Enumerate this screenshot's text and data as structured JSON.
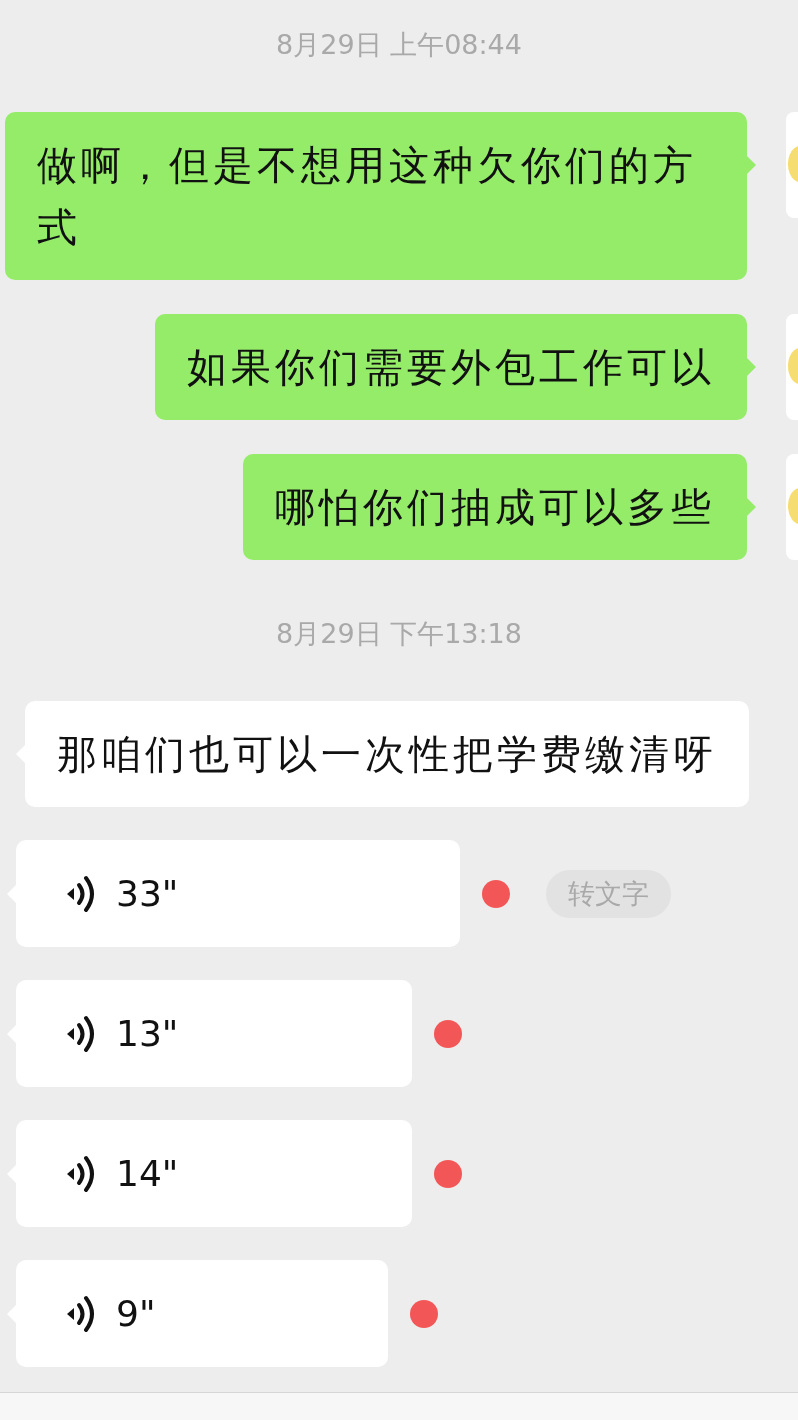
{
  "messages": [
    {
      "kind": "timestamp",
      "text": "8月29日 上午08:44"
    },
    {
      "kind": "sent_text",
      "text": "做啊，但是不想用这种欠你们的方式"
    },
    {
      "kind": "sent_text",
      "text": "如果你们需要外包工作可以"
    },
    {
      "kind": "sent_text",
      "text": "哪怕你们抽成可以多些"
    },
    {
      "kind": "timestamp",
      "text": "8月29日 下午13:18"
    },
    {
      "kind": "received_text",
      "text": "那咱们也可以一次性把学费缴清呀"
    },
    {
      "kind": "voice",
      "duration": "33\"",
      "unread": true,
      "transcribe_label": "转文字"
    },
    {
      "kind": "voice",
      "duration": "13\"",
      "unread": true
    },
    {
      "kind": "voice",
      "duration": "14\"",
      "unread": true
    },
    {
      "kind": "voice",
      "duration": "9\"",
      "unread": true
    }
  ]
}
